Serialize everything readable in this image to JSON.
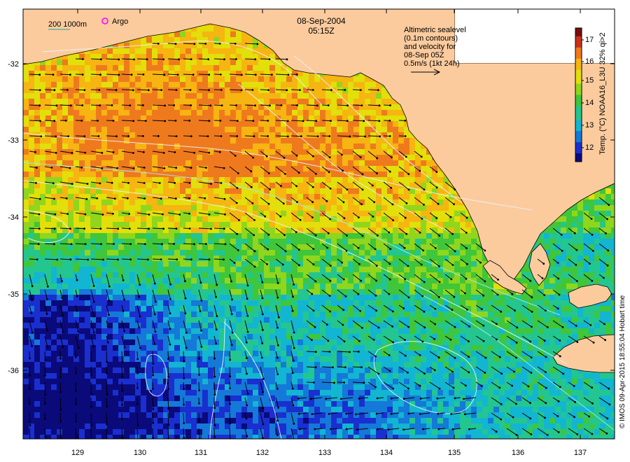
{
  "map": {
    "date_label": "08-Sep-2004",
    "time_label": "05:15Z",
    "scale_label": "200  1000m",
    "argo_label": "Argo",
    "legend_lines": [
      "Altimetric sealevel",
      "(0.1m contours)",
      "and velocity for",
      "08-Sep 05Z",
      "0.5m/s (1kt 24h)"
    ],
    "colorbar_title": "Temp. (°C) NOAA16_L3U 32% qi>2",
    "colorbar_ticks": [
      "12",
      "13",
      "14",
      "15",
      "16",
      "17"
    ],
    "credit": "© IMOS 09-Apr-2015 18:55:04 Hobart time",
    "x_ticks": [
      "129",
      "130",
      "131",
      "132",
      "133",
      "134",
      "135",
      "136",
      "137"
    ],
    "y_ticks": [
      "-32",
      "-33",
      "-34",
      "-35",
      "-36"
    ],
    "lon_range": [
      128.2,
      137.6
    ],
    "lat_range": [
      -36.9,
      -31.3
    ],
    "colorbar_range": [
      11.5,
      17.5
    ]
  },
  "colors": {
    "land": "#fbcb9e",
    "frame": "#000000",
    "contour": "#e8f4ff",
    "contour_cyan": "#9fe8ff",
    "argo": "#ff00ff",
    "scale_bar": "#1aa7a0",
    "sst_scale": [
      "#0a0a7a",
      "#1a2fd0",
      "#1479d8",
      "#12b5d2",
      "#23c68f",
      "#3fc63a",
      "#8fd61d",
      "#e2df0a",
      "#f6b511",
      "#ef7a1d",
      "#c9321a",
      "#7a0e0e"
    ]
  }
}
